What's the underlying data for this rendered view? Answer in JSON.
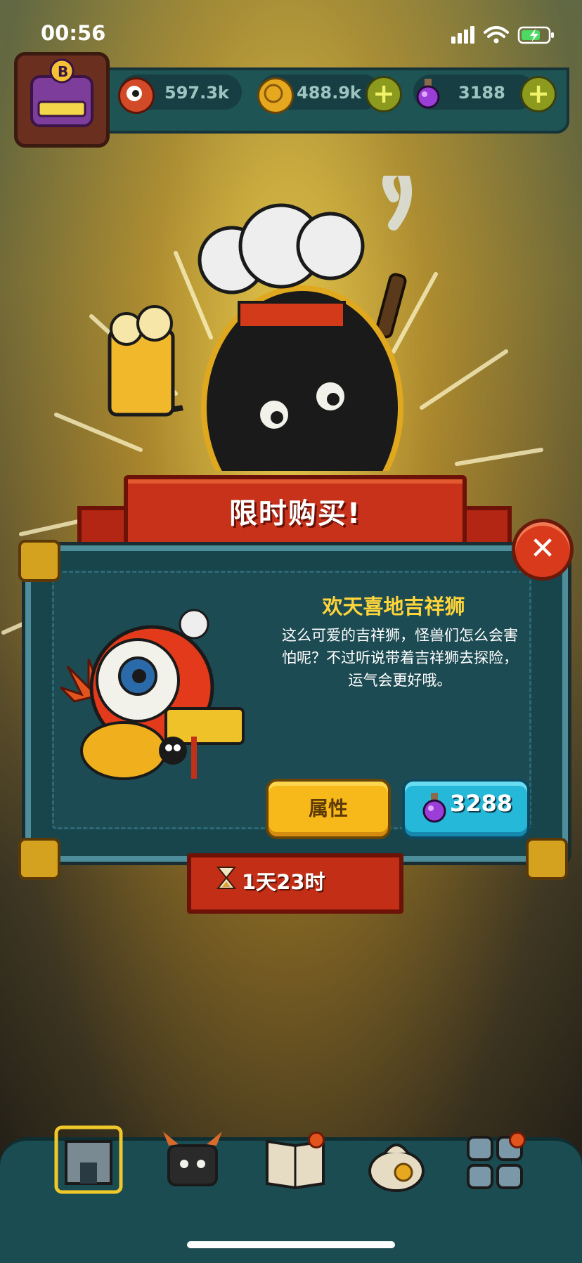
{
  "status_bar": {
    "time": "00:56"
  },
  "resources": {
    "eyeballs": {
      "value": "597.3k",
      "icon": "eyeball-icon"
    },
    "coins": {
      "value": "488.9k",
      "icon": "coin-icon"
    },
    "potions": {
      "value": "3188",
      "icon": "potion-icon"
    }
  },
  "offer": {
    "banner_title": "限时购买!",
    "item_name": "欢天喜地吉祥狮",
    "description_lines": [
      "这么可爱的吉祥狮，怪兽们怎么会害",
      "怕呢？不过听说带着吉祥狮去探险，",
      "运气会更好哦。"
    ],
    "attributes_label": "属性",
    "price": "3288",
    "timer": "1天23时"
  },
  "avatar": {
    "letter": "B"
  },
  "colors": {
    "accent_gold": "#ffd53a",
    "banner_red": "#c8321a",
    "panel_teal": "#18444c",
    "price_button": "#26b8d9"
  },
  "bottom_nav": [
    "shop-icon",
    "monster-icon",
    "book-icon",
    "bag-icon",
    "grid-icon"
  ]
}
